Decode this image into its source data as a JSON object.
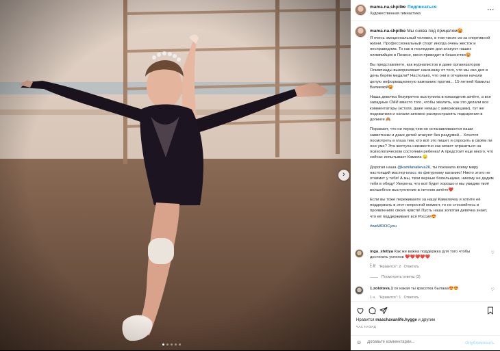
{
  "post": {
    "username": "mama.na.shpilke",
    "separator": "•",
    "follow_label": "Подписаться",
    "subtitle": "Художественная гимнастика",
    "more_label": "···",
    "next_label": "›",
    "carousel_count": 5,
    "carousel_index": 1
  },
  "caption": {
    "username": "mama.na.shpilke",
    "headline": "Мы снова под прицелом😡",
    "paragraphs": [
      "Я очень эмоциональный человек, в том числе из-за спортивной жизни. Профессиональный спорт иногда очень жесток и несправедлив. То как в последние дни атакуют наших олимпийцев в Пекине, меня приводит в бешенство😡",
      "Вы представляете, как журналистов и даже организаторов Олимпиады выворачивает наизнанку от того, что мы изо дня в день берём медали? Настолько, что они в отчаянии начали целую информационную кампанию против... 15-летней Камилы Валиевой😡",
      "Наша девочка безупречно выступила в командном зачёте, а все западные СМИ вместо того, чтобы хвалить, как это делали все комментаторы (кстати, даже немцы с американцами), тут же подхватили и начали активно распространять подозрения в допинге 🙈",
      "Поражает, что ни перед чем не останавливаются наши завистники и даже детей атакуют без раздумий... Хочется посмотреть в глаза тем, кто всё это пишет и спросить в своём ли они уме? Эта желтуха неизвестно как может отразиться на психологическом состоянии ребенка! А предстоит еще много, что сейчас испытывает Камила 😞"
    ],
    "tag_paragraph_before": "Дорогая наша ",
    "tag_mention": "@kamilavalieva26",
    "tag_paragraph_after": ", ты показала всему миру настоящий мастер-класс по фигурному катанию! Никто этого не отнимет у тебя! А мы, твои верные болельщики, никому не дадим тебя в обиду! Уверена, что всё будет хорошо и мы увидим твоё волшебное выступление в личном зачёте❤️",
    "closing": "Если вы тоже переживаете за нашу Камилочку и хотите её поддержать в этот непростой момент, то не стесняйтесь в проявлениях своих чувств! Пусть наша золотая девочка знает, что её поддерживает вся Россия😍",
    "hashtag": "#weWROCyou",
    "time": "1 н."
  },
  "comments": [
    {
      "username": "inga_sfetlya",
      "text": "Как же важна поддержка для того чтобы достигать успехов ❤️❤️❤️❤️❤️",
      "time": "1 н.",
      "likes_label": "\"Нравится\": 2",
      "reply_label": "Ответить",
      "view_replies": "Посмотреть ответы (3)"
    },
    {
      "username": "1.zolotova.1",
      "text": "ох какая ты красотка былааа😍😍",
      "time": "1 н.",
      "likes_label": "\"Нравится\": 1",
      "reply_label": "Ответить"
    }
  ],
  "actions": {
    "likes_prefix": "Нравится ",
    "likes_user": "maschavanlife.hygge",
    "likes_suffix": " и другим",
    "ago": "ЧАС НАЗАД"
  },
  "add_comment": {
    "placeholder": "Добавьте комментарий...",
    "publish_label": "Опубликовать"
  },
  "colors": {
    "link_blue": "#0095f6",
    "mention_blue": "#00376b",
    "publish_disabled": "#b2dffc",
    "muted": "#737373"
  }
}
